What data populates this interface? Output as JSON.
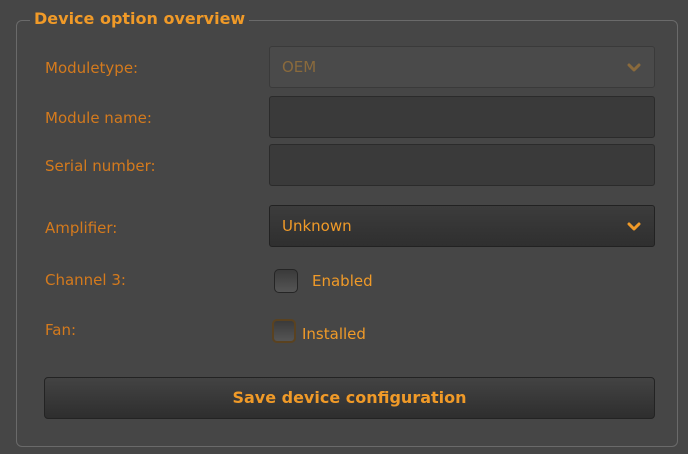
{
  "group": {
    "title": "Device option overview"
  },
  "fields": {
    "moduletype": {
      "label": "Moduletype:",
      "value": "OEM",
      "icon": "chevron-down-icon",
      "disabled": true
    },
    "module_name": {
      "label": "Module name:",
      "value": ""
    },
    "serial_number": {
      "label": "Serial number:",
      "value": ""
    },
    "amplifier": {
      "label": "Amplifier:",
      "value": "Unknown",
      "icon": "chevron-down-icon"
    },
    "channel3": {
      "label": "Channel 3:",
      "checkbox_label": "Enabled",
      "checked": false
    },
    "fan": {
      "label": "Fan:",
      "checkbox_label": "Installed",
      "checked": false
    }
  },
  "actions": {
    "save_label": "Save device configuration"
  },
  "colors": {
    "accent": "#f09a28",
    "label": "#d47a1d",
    "background": "#464646"
  }
}
